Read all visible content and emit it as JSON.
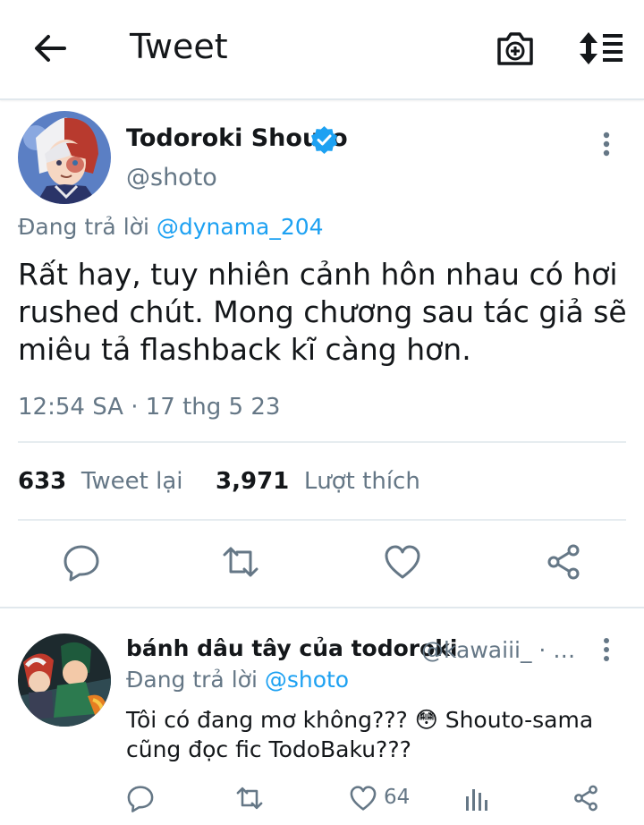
{
  "header": {
    "title": "Tweet"
  },
  "tweet": {
    "author_name": "Todoroki Shouto",
    "author_handle": "@shoto",
    "reply_prefix": "Đang trả lời",
    "reply_mention": "@dynama_204",
    "text": "Rất hay, tuy nhiên cảnh hôn nhau có hơi rushed chút. Mong chương sau tác giả sẽ miêu tả flashback kĩ càng hơn.",
    "timestamp": "12:54 SA · 17 thg 5 23",
    "retweet_count": "633",
    "retweet_label": "Tweet lại",
    "like_count": "3,971",
    "like_label": "Lượt thích"
  },
  "reply": {
    "author_name": "bánh dâu tây của todoroki",
    "author_handle": "@kawaiii_ · …",
    "reply_prefix": "Đang trả lời",
    "reply_mention": "@shoto",
    "text_line1": "Tôi có đang mơ không??? 😳 Shouto-sama",
    "text_line2": "cũng đọc fic TodoBaku???",
    "like_count": "64"
  },
  "colors": {
    "accent": "#1da1f2",
    "secondary_text": "#657786",
    "divider": "#e6ecf0"
  },
  "icons": [
    "back-arrow-icon",
    "camera-add-icon",
    "sort-icon",
    "verified-badge-icon",
    "more-vertical-icon",
    "reply-icon",
    "retweet-icon",
    "like-icon",
    "share-icon",
    "analytics-icon"
  ]
}
